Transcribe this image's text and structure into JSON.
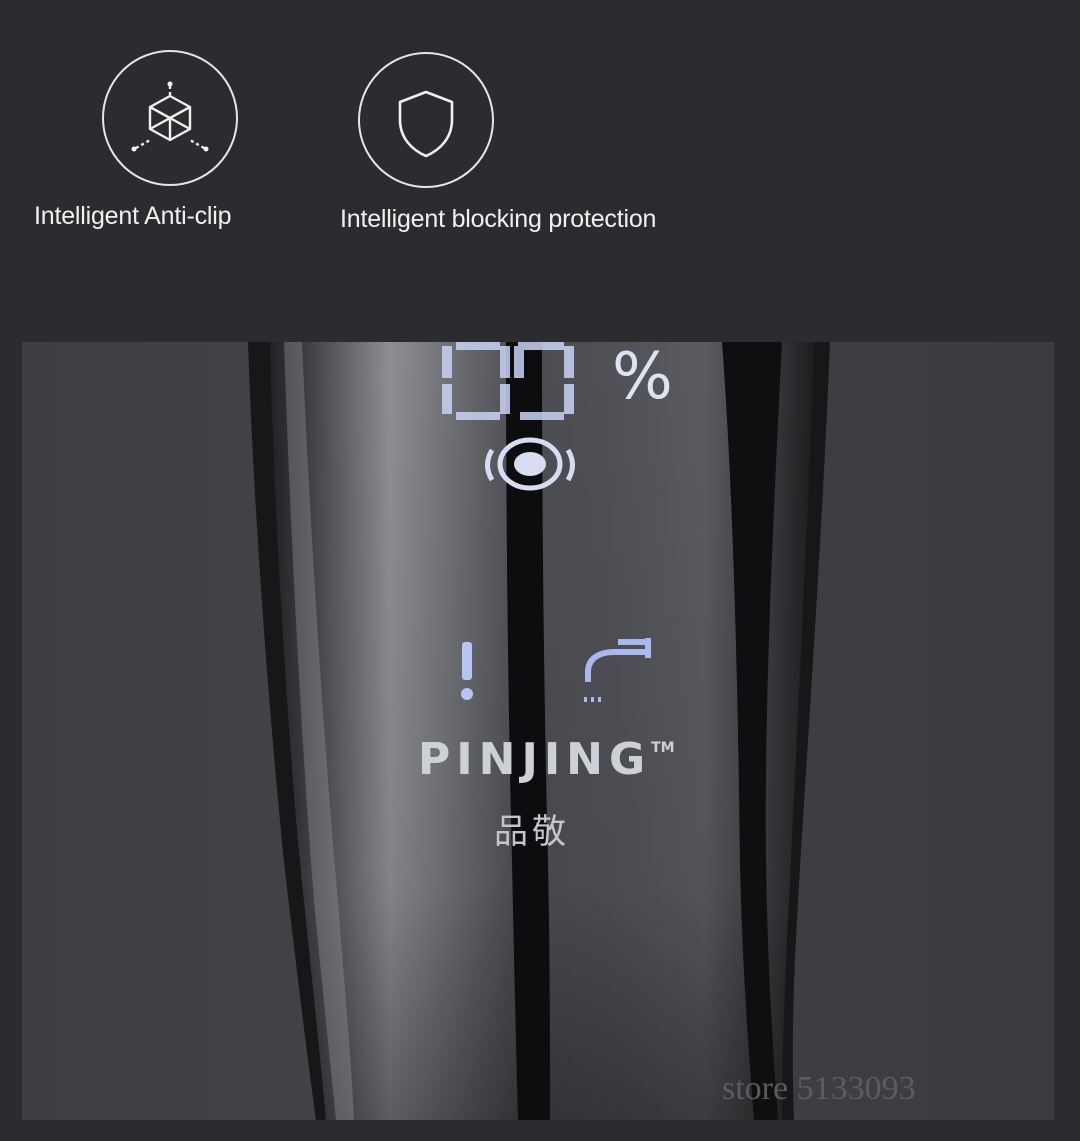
{
  "features": [
    {
      "icon": "cube-icon",
      "label": "Intelligent Anti-clip"
    },
    {
      "icon": "shield-icon",
      "label": "Intelligent blocking protection"
    }
  ],
  "product": {
    "display_unit": "%",
    "brand": "PINJING",
    "trademark": "TM",
    "brand_cn": "品敬",
    "indicator_icons": [
      "battery-level-icon",
      "warning-icon",
      "faucet-icon"
    ]
  },
  "watermark": "store 5133093",
  "colors": {
    "background": "#2b2c2f",
    "accent": "#aab8f0"
  }
}
